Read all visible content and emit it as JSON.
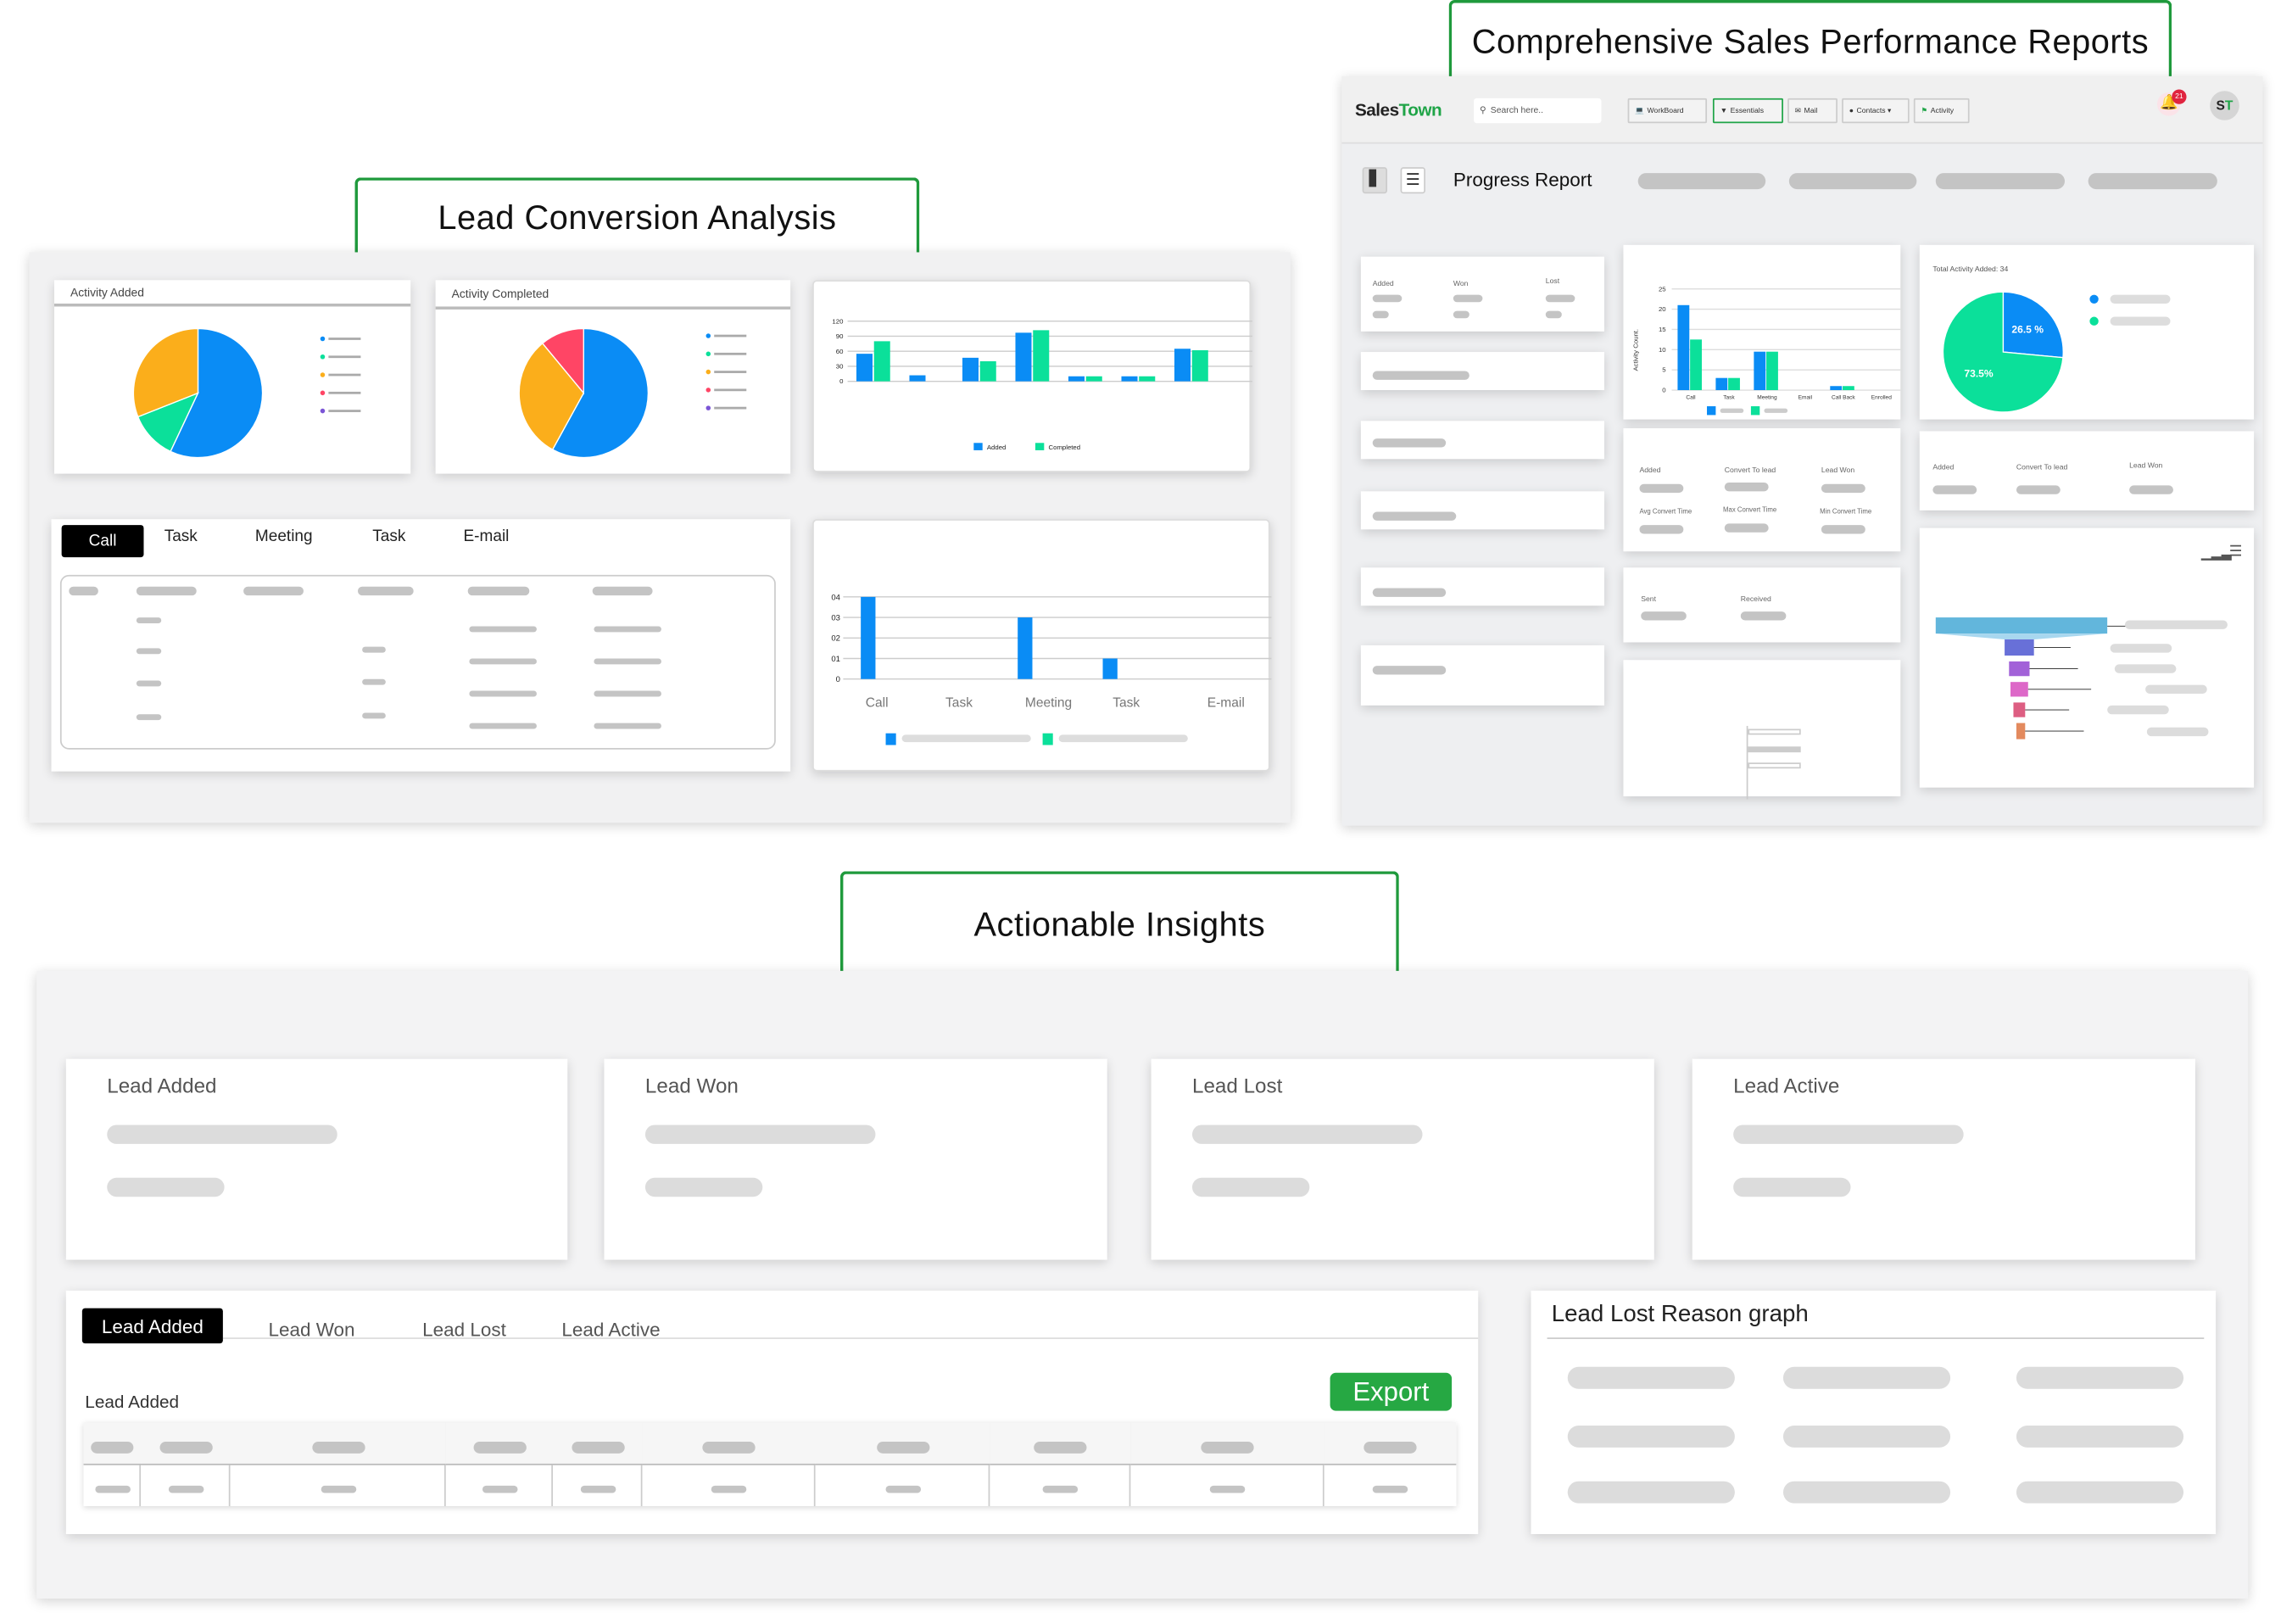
{
  "sections": {
    "lead_conversion": "Lead Conversion Analysis",
    "sales_reports": "Comprehensive Sales Performance Reports",
    "insights": "Actionable Insights"
  },
  "lead_conversion": {
    "activity_added": {
      "title": "Activity Added",
      "slices": [
        {
          "value": 57,
          "color": "#0a8cf5"
        },
        {
          "value": 12,
          "color": "#0be09a"
        },
        {
          "value": 31,
          "color": "#fbae1b"
        }
      ],
      "legend_colors": [
        "#0a8cf5",
        "#0be09a",
        "#fbae1b",
        "#ff4565",
        "#7b55d6"
      ]
    },
    "activity_completed": {
      "title": "Activity Completed",
      "slices": [
        {
          "value": 58,
          "color": "#0a8cf5"
        },
        {
          "value": 31,
          "color": "#fbae1b"
        },
        {
          "value": 11,
          "color": "#ff4565"
        }
      ],
      "legend_colors": [
        "#0a8cf5",
        "#0be09a",
        "#fbae1b",
        "#ff4565",
        "#7b55d6"
      ]
    },
    "activity_bar": {
      "type": "bar",
      "ylim": [
        0,
        120
      ],
      "yticks": [
        "0",
        "30",
        "60",
        "90",
        "120"
      ],
      "series": [
        {
          "name": "Added",
          "color": "#0a8cf5",
          "values": [
            55,
            12,
            47,
            97,
            10,
            10,
            65
          ]
        },
        {
          "name": "Completed",
          "color": "#0be09a",
          "values": [
            80,
            0,
            40,
            102,
            10,
            10,
            62
          ]
        }
      ]
    },
    "tabs": [
      "Call",
      "Task",
      "Meeting",
      "Task",
      "E-mail"
    ],
    "active_tab": 0,
    "type_bar": {
      "type": "bar",
      "ylim": [
        0,
        4
      ],
      "yticks": [
        "0",
        "01",
        "02",
        "03",
        "04"
      ],
      "categories": [
        "Call",
        "Task",
        "Meeting",
        "Task",
        "E-mail"
      ],
      "values": [
        4,
        0,
        3,
        1,
        0
      ],
      "color": "#0a8cf5",
      "legend_colors": [
        "#0a8cf5",
        "#0be09a"
      ]
    }
  },
  "app": {
    "logo_part1": "Sales",
    "logo_part2": "Town",
    "search_placeholder": "Search here..",
    "nav": [
      {
        "label": "WorkBoard",
        "icon": "monitor-icon",
        "active": false
      },
      {
        "label": "Essentials",
        "icon": "pin-icon",
        "active": true
      },
      {
        "label": "Mail",
        "icon": "mail-icon",
        "active": false
      },
      {
        "label": "Contacts ▾",
        "icon": "person-icon",
        "active": false
      },
      {
        "label": "Activity",
        "icon": "flag-icon",
        "active": false
      }
    ],
    "notifications": "21",
    "avatar_s": "S",
    "avatar_t": "T",
    "page_title": "Progress Report",
    "summary": {
      "added": "Added",
      "won": "Won",
      "lost": "Lost"
    },
    "activity_chart": {
      "type": "bar",
      "ylabel": "Activity Count.",
      "ylim": [
        0,
        25
      ],
      "yticks": [
        "0",
        "5",
        "10",
        "15",
        "20",
        "25"
      ],
      "categories": [
        "Call",
        "Task",
        "Meeting",
        "Email",
        "Call Back",
        "Enrolled"
      ],
      "series": [
        {
          "color": "#0a8cf5",
          "values": [
            21,
            3,
            9.5,
            0,
            1,
            0
          ]
        },
        {
          "color": "#0be09a",
          "values": [
            12.5,
            3,
            9.5,
            0,
            1,
            0
          ]
        }
      ]
    },
    "total_pie": {
      "title": "Total Activity Added: 34",
      "slices": [
        {
          "value": 26.5,
          "label": "26.5 %",
          "color": "#0a8cf5"
        },
        {
          "value": 73.5,
          "label": "73.5%",
          "color": "#0be09a"
        }
      ]
    },
    "conversion": {
      "added": "Added",
      "convert": "Convert To lead",
      "won": "Lead Won",
      "avg": "Avg Convert Time",
      "max": "Max Convert Time",
      "min": "Min Convert Time"
    },
    "mail": {
      "sent": "Sent",
      "received": "Received"
    },
    "leads_mini": {
      "added": "Added",
      "convert": "Convert To lead",
      "won": "Lead Won"
    },
    "funnel_colors": [
      "#62b6dc",
      "#6870d8",
      "#a262d8",
      "#dd68c8",
      "#dd5e82",
      "#e38a5e"
    ]
  },
  "insights": {
    "kpis": [
      "Lead Added",
      "Lead Won",
      "Lead Lost",
      "Lead Active"
    ],
    "tabs": [
      "Lead Added",
      "Lead Won",
      "Lead Lost",
      "Lead Active"
    ],
    "active_tab": 0,
    "table_title": "Lead Added",
    "export": "Export",
    "reason_title": "Lead Lost Reason graph"
  }
}
